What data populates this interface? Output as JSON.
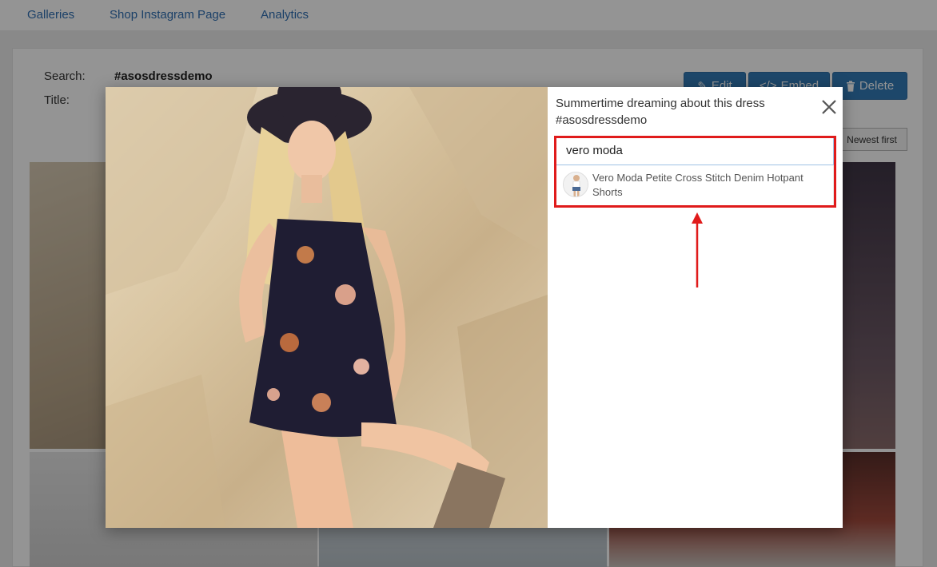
{
  "nav": {
    "items": [
      "Galleries",
      "Shop Instagram Page",
      "Analytics"
    ]
  },
  "gallery": {
    "search_label": "Search:",
    "search_value": "#asosdressdemo",
    "title_label": "Title:",
    "edit_label": "Edit",
    "embed_label": "Embed",
    "delete_label": "Delete",
    "sort_label": "Newest first"
  },
  "modal": {
    "caption": "Summertime dreaming about this dress #asosdressdemo",
    "search_value": "vero moda",
    "result_label": "Vero Moda Petite Cross Stitch Denim Hotpant Shorts"
  },
  "colors": {
    "accent": "#337ab7",
    "highlight": "#e01b1b",
    "link": "#2f6fb3"
  }
}
